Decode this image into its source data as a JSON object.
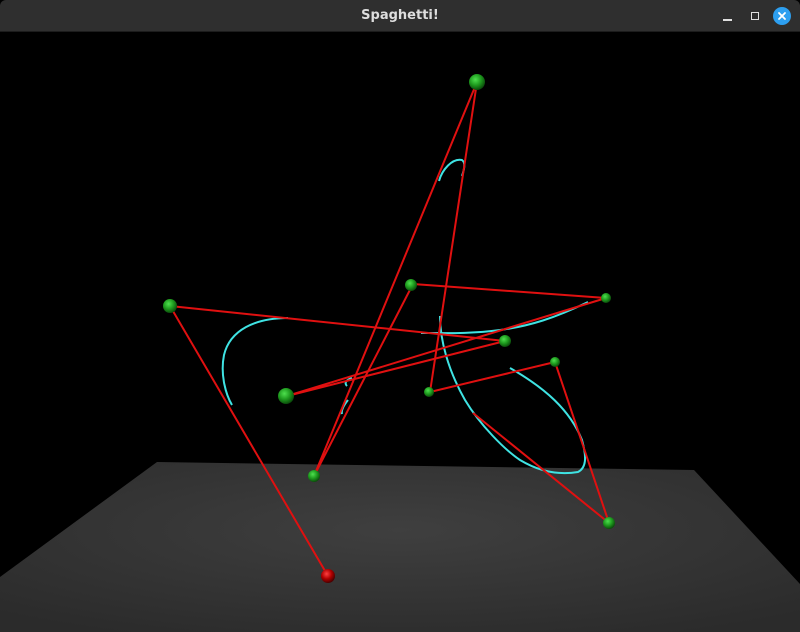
{
  "window": {
    "title": "Spaghetti!"
  },
  "controls": {
    "minimize": "minimize-icon",
    "maximize": "maximize-icon",
    "close": "close-icon"
  },
  "colors": {
    "titlebar": "#2f2f2f",
    "background": "#000000",
    "ground": "#3a3a3a",
    "control_polygon": "#e01010",
    "curve": "#3fe3e3",
    "control_point": "#1f9a1f",
    "selected_point": "#b00000",
    "close_button": "#2d9ff0"
  }
}
